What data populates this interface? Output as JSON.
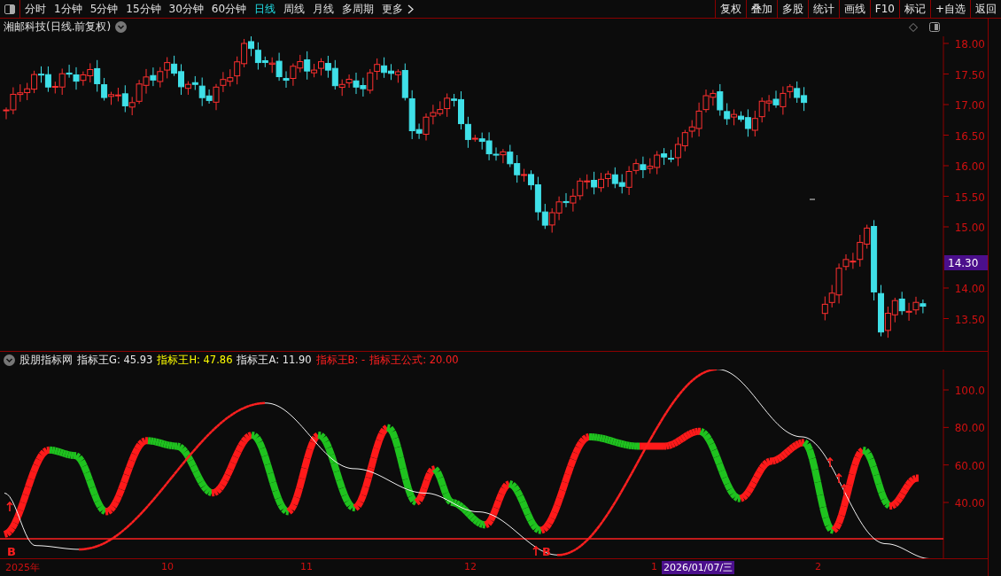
{
  "toolbar": {
    "periods": [
      {
        "label": "分时",
        "selected": false
      },
      {
        "label": "1分钟",
        "selected": false
      },
      {
        "label": "5分钟",
        "selected": false
      },
      {
        "label": "15分钟",
        "selected": false
      },
      {
        "label": "30分钟",
        "selected": false
      },
      {
        "label": "60分钟",
        "selected": false
      },
      {
        "label": "日线",
        "selected": true
      },
      {
        "label": "周线",
        "selected": false
      },
      {
        "label": "月线",
        "selected": false
      },
      {
        "label": "多周期",
        "selected": false
      },
      {
        "label": "更多",
        "selected": false
      }
    ],
    "buttons": [
      "复权",
      "叠加",
      "多股",
      "统计",
      "画线",
      "F10",
      "标记",
      "+自选",
      "返回"
    ]
  },
  "main_chart": {
    "title": "湘邮科技(日线.前复权)",
    "price_labels": [
      "18.00",
      "17.50",
      "17.00",
      "16.50",
      "16.00",
      "15.50",
      "15.00",
      "14.00",
      "13.50"
    ],
    "last_price": "14.30"
  },
  "indicator": {
    "name": "股朋指标网",
    "legend": [
      {
        "label": "指标王G: 45.93",
        "color": "#e8e8e8"
      },
      {
        "label": "指标王H: 47.86",
        "color": "#ffff00"
      },
      {
        "label": "指标王A: 11.90",
        "color": "#e8e8e8"
      },
      {
        "label": "指标王B: -",
        "color": "#ff2020"
      },
      {
        "label": "指标王公式: 20.00",
        "color": "#ff2020"
      }
    ],
    "axis_labels": [
      "100.0",
      "80.00",
      "60.00",
      "40.00"
    ],
    "signals": [
      "B",
      "B"
    ]
  },
  "date_axis": {
    "labels": [
      {
        "label": "2025年",
        "selected": false
      },
      {
        "label": "10",
        "selected": false
      },
      {
        "label": "11",
        "selected": false
      },
      {
        "label": "12",
        "selected": false
      },
      {
        "label": "1",
        "selected": false
      },
      {
        "label": "2026/01/07/三",
        "selected": true
      },
      {
        "label": "2",
        "selected": false
      }
    ]
  }
}
